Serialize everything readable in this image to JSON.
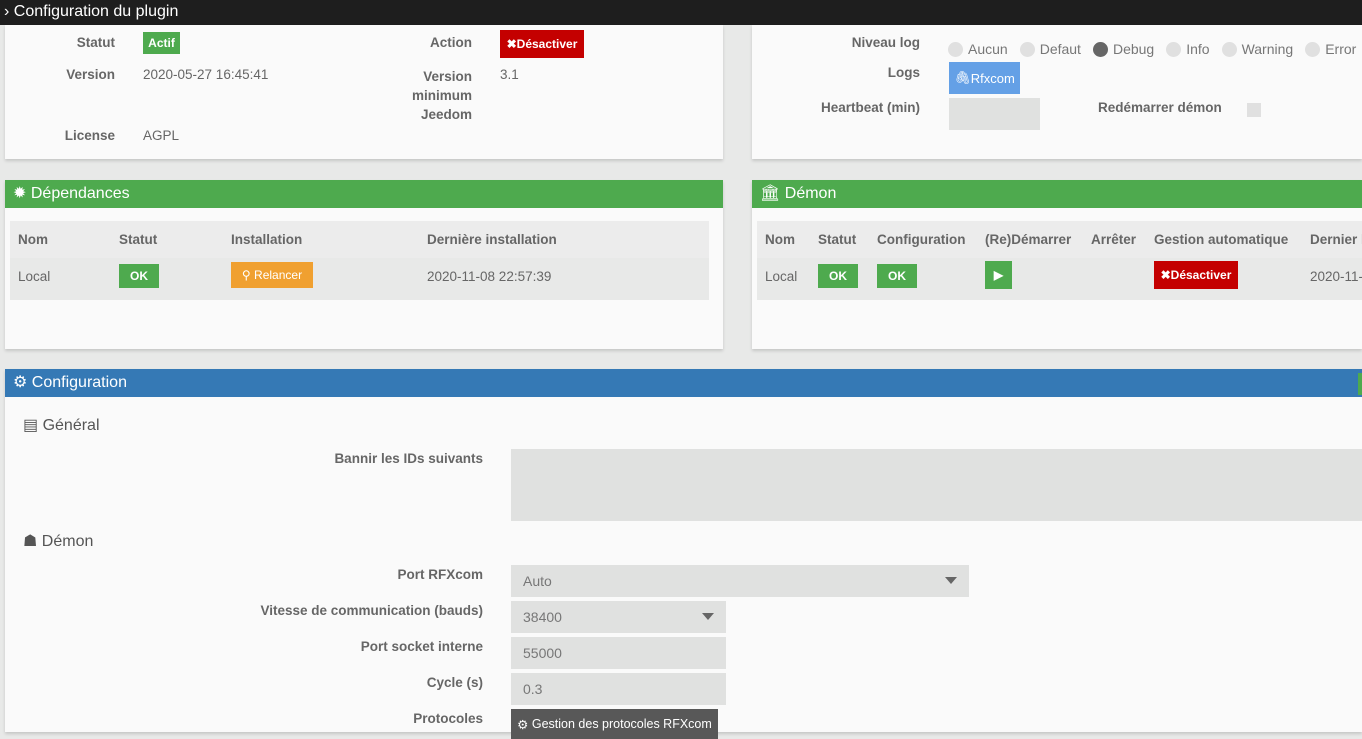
{
  "topbar": {
    "title": "Configuration du plugin"
  },
  "info": {
    "statut_label": "Statut",
    "statut_value": "Actif",
    "version_label": "Version",
    "version_value": "2020-05-27 16:45:41",
    "license_label": "License",
    "license_value": "AGPL",
    "action_label": "Action",
    "action_button": "Désactiver",
    "min_version_label_1": "Version",
    "min_version_label_2": "minimum",
    "min_version_label_3": "Jeedom",
    "min_version_value": "3.1"
  },
  "log": {
    "niveau_label": "Niveau log",
    "levels": [
      "Aucun",
      "Defaut",
      "Debug",
      "Info",
      "Warning",
      "Error"
    ],
    "selected": "Debug",
    "logs_label": "Logs",
    "logs_button": "Rfxcom",
    "heartbeat_label": "Heartbeat (min)",
    "heartbeat_value": "",
    "restart_label": "Redémarrer démon"
  },
  "deps": {
    "title": "Dépendances",
    "headers": [
      "Nom",
      "Statut",
      "Installation",
      "Dernière installation"
    ],
    "row": {
      "nom": "Local",
      "statut": "OK",
      "installation": "Relancer",
      "date": "2020-11-08 22:57:39"
    }
  },
  "daemon": {
    "title": "Démon",
    "headers": [
      "Nom",
      "Statut",
      "Configuration",
      "(Re)Démarrer",
      "Arrêter",
      "Gestion automatique",
      "Dernier l"
    ],
    "row": {
      "nom": "Local",
      "statut": "OK",
      "configuration": "OK",
      "gestion": "Désactiver",
      "dernier": "2020-11-"
    }
  },
  "config": {
    "title": "Configuration",
    "general_title": "Général",
    "bannir_label": "Bannir les IDs suivants",
    "bannir_value": "",
    "demon_title": "Démon",
    "port_label": "Port RFXcom",
    "port_value": "Auto",
    "vitesse_label": "Vitesse de communication (bauds)",
    "vitesse_value": "38400",
    "socket_label": "Port socket interne",
    "socket_value": "55000",
    "cycle_label": "Cycle (s)",
    "cycle_value": "0.3",
    "protocoles_label": "Protocoles",
    "protocoles_button": "Gestion des protocoles RFXcom"
  }
}
